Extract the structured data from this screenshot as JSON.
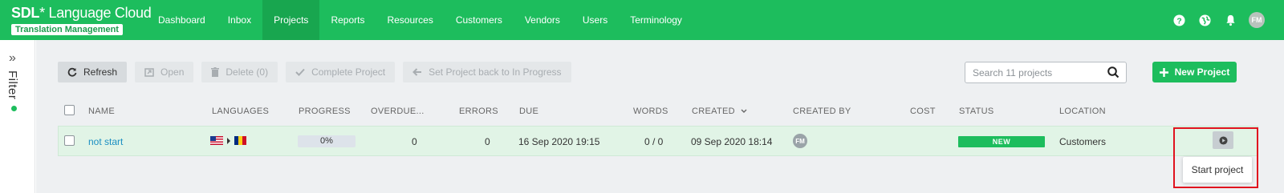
{
  "brand": {
    "name_bold": "SDL",
    "name_rest": "* Language Cloud",
    "subtitle": "Translation Management"
  },
  "nav": [
    "Dashboard",
    "Inbox",
    "Projects",
    "Reports",
    "Resources",
    "Customers",
    "Vendors",
    "Users",
    "Terminology"
  ],
  "nav_active": "Projects",
  "user": {
    "initials": "FM"
  },
  "sidebar": {
    "filter_label": "Filter"
  },
  "toolbar": {
    "refresh": "Refresh",
    "open": "Open",
    "delete": "Delete (0)",
    "complete": "Complete Project",
    "set_back": "Set Project back to In Progress"
  },
  "search": {
    "placeholder": "Search 11 projects",
    "value": ""
  },
  "new_project": "New Project",
  "columns": {
    "name": "NAME",
    "languages": "LANGUAGES",
    "progress": "PROGRESS",
    "overdue": "OVERDUE...",
    "errors": "ERRORS",
    "due": "DUE",
    "words": "WORDS",
    "created": "CREATED",
    "created_by": "CREATED BY",
    "cost": "COST",
    "status": "STATUS",
    "location": "LOCATION"
  },
  "rows": [
    {
      "name": "not start",
      "languages": {
        "source_flag": "us-flag-icon",
        "target_flag": "romania-flag-icon"
      },
      "progress": "0%",
      "overdue": "0",
      "errors": "0",
      "due": "16 Sep 2020 19:15",
      "words": "0 / 0",
      "created": "09 Sep 2020 18:14",
      "created_by": "FM",
      "cost": "",
      "status": "NEW",
      "location": "Customers"
    }
  ],
  "tooltip": "Start project",
  "colors": {
    "brand_green": "#1dbd5d",
    "highlight_red": "#e0131f",
    "link_blue": "#1a8fc2"
  }
}
